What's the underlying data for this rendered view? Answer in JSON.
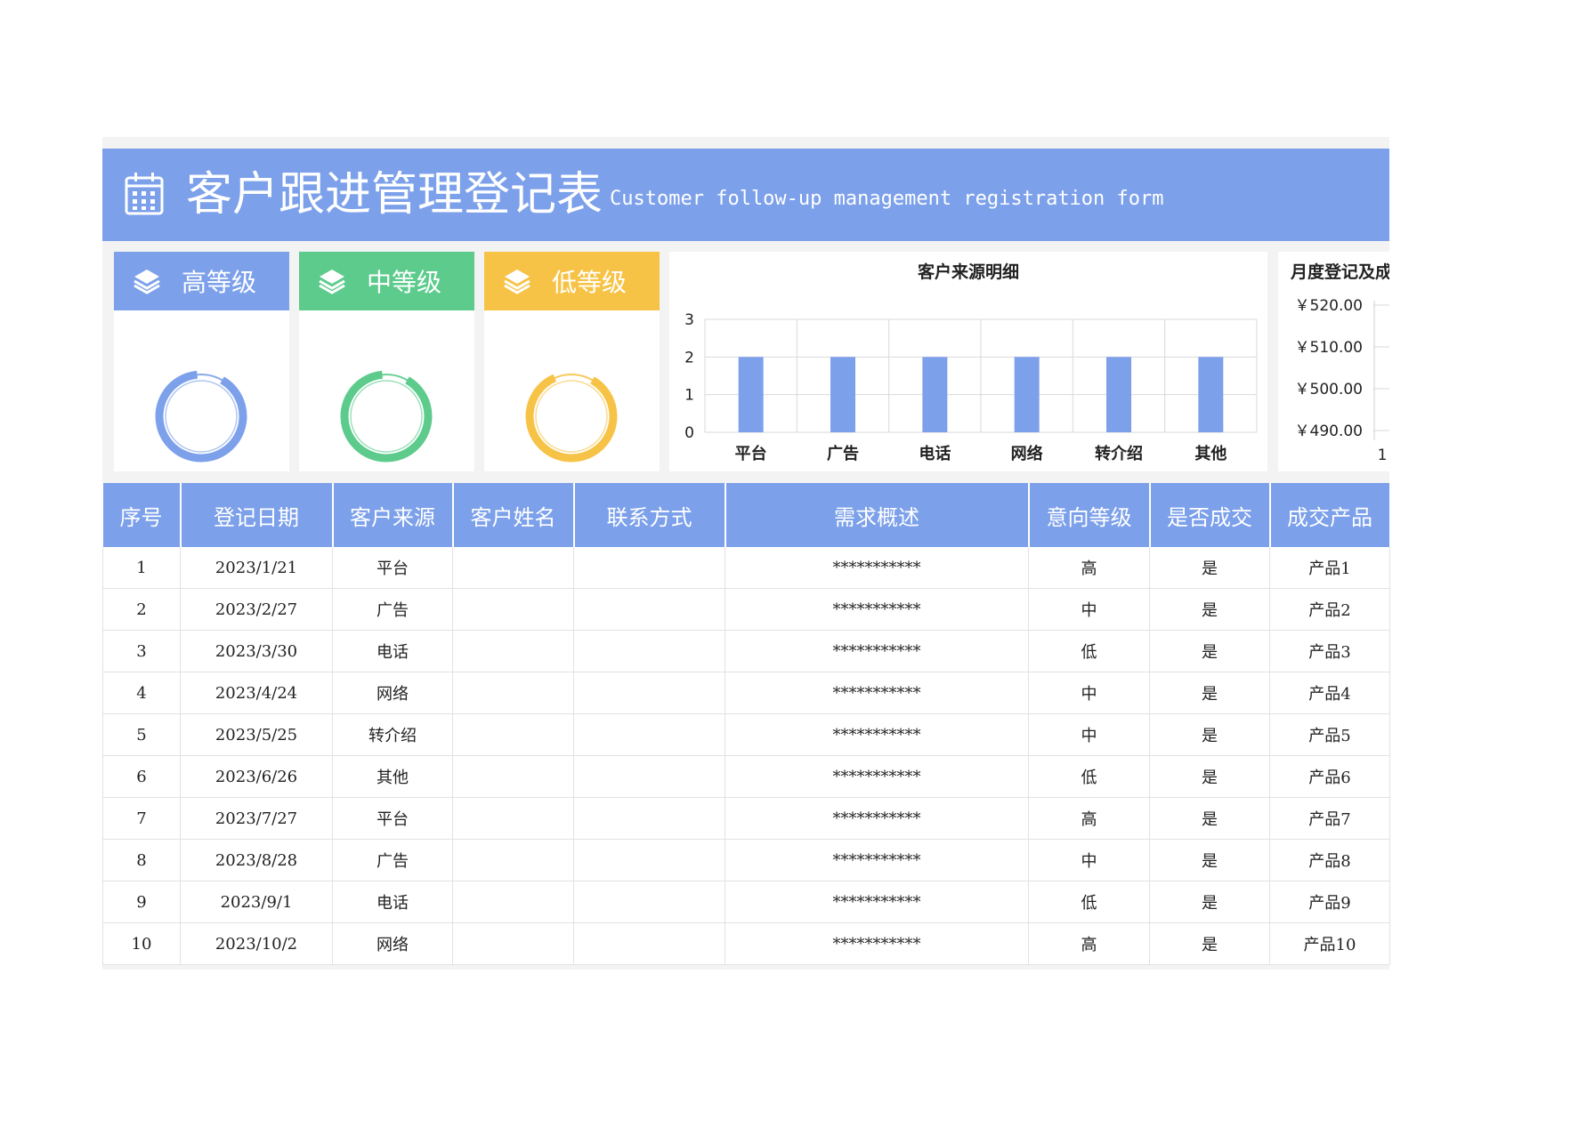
{
  "header": {
    "title_cn": "客户跟进管理登记表",
    "title_en": "Customer follow-up management registration form",
    "icon": "calendar-icon"
  },
  "levels": [
    {
      "label": "高等级",
      "color": "#7ca0ea",
      "icon": "layers-icon",
      "fill": 0.9
    },
    {
      "label": "中等级",
      "color": "#5ccb8c",
      "icon": "layers-icon",
      "fill": 0.9
    },
    {
      "label": "低等级",
      "color": "#f7c346",
      "icon": "layers-icon",
      "fill": 0.85
    }
  ],
  "chart_data": [
    {
      "type": "bar",
      "title": "客户来源明细",
      "categories": [
        "平台",
        "广告",
        "电话",
        "网络",
        "转介绍",
        "其他"
      ],
      "values": [
        2,
        2,
        2,
        2,
        2,
        2
      ],
      "ylim": [
        0,
        3
      ],
      "yticks": [
        "0",
        "1",
        "2",
        "3"
      ],
      "grid": true,
      "color": "#7ca0ea"
    },
    {
      "type": "line",
      "title": "月度登记及成",
      "yticks": [
        "￥490.00",
        "￥510.00",
        "￥500.00",
        "￥520.00"
      ],
      "ytick_order": [
        "￥520.00",
        "￥510.00",
        "￥500.00",
        "￥490.00"
      ],
      "x_first_tick": "1"
    }
  ],
  "table": {
    "headers": [
      "序号",
      "登记日期",
      "客户来源",
      "客户姓名",
      "联系方式",
      "需求概述",
      "意向等级",
      "是否成交",
      "成交产品"
    ],
    "rows": [
      [
        "1",
        "2023/1/21",
        "平台",
        "",
        "",
        "***********",
        "高",
        "是",
        "产品1"
      ],
      [
        "2",
        "2023/2/27",
        "广告",
        "",
        "",
        "***********",
        "中",
        "是",
        "产品2"
      ],
      [
        "3",
        "2023/3/30",
        "电话",
        "",
        "",
        "***********",
        "低",
        "是",
        "产品3"
      ],
      [
        "4",
        "2023/4/24",
        "网络",
        "",
        "",
        "***********",
        "中",
        "是",
        "产品4"
      ],
      [
        "5",
        "2023/5/25",
        "转介绍",
        "",
        "",
        "***********",
        "中",
        "是",
        "产品5"
      ],
      [
        "6",
        "2023/6/26",
        "其他",
        "",
        "",
        "***********",
        "低",
        "是",
        "产品6"
      ],
      [
        "7",
        "2023/7/27",
        "平台",
        "",
        "",
        "***********",
        "高",
        "是",
        "产品7"
      ],
      [
        "8",
        "2023/8/28",
        "广告",
        "",
        "",
        "***********",
        "中",
        "是",
        "产品8"
      ],
      [
        "9",
        "2023/9/1",
        "电话",
        "",
        "",
        "***********",
        "低",
        "是",
        "产品9"
      ],
      [
        "10",
        "2023/10/2",
        "网络",
        "",
        "",
        "***********",
        "高",
        "是",
        "产品10"
      ]
    ]
  }
}
